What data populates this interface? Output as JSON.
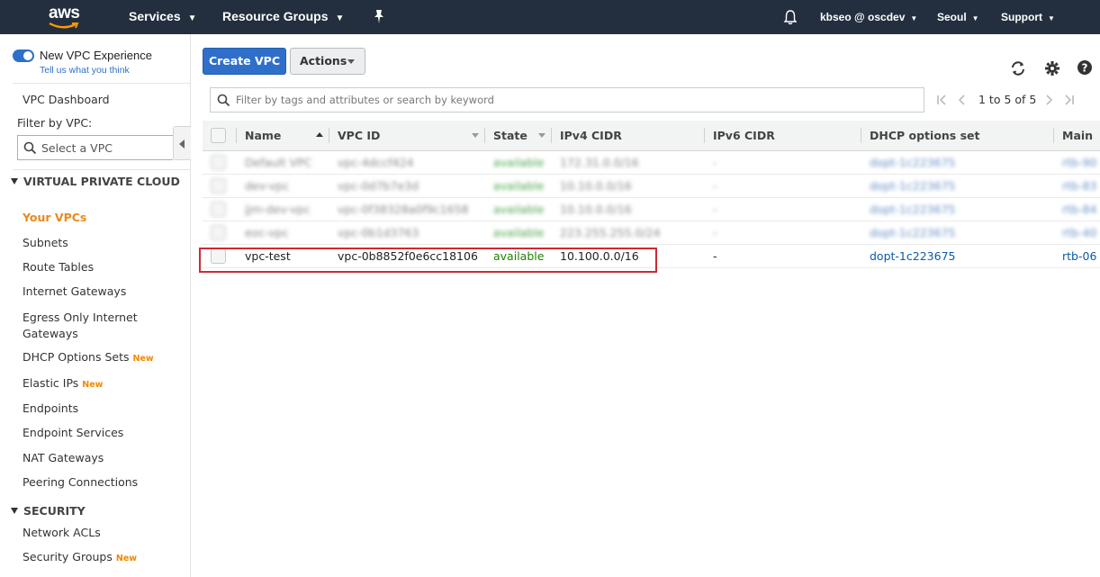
{
  "topnav": {
    "logo_text": "aws",
    "services": "Services",
    "resource_groups": "Resource Groups",
    "user": "kbseo @ oscdev",
    "region": "Seoul",
    "support": "Support"
  },
  "sidebar": {
    "experience_label": "New VPC Experience",
    "experience_link": "Tell us what you think",
    "dashboard": "VPC Dashboard",
    "filter_label": "Filter by VPC:",
    "select_placeholder": "Select a VPC",
    "section_vpc": "VIRTUAL PRIVATE CLOUD",
    "section_security": "SECURITY",
    "new_badge": "New",
    "items": [
      {
        "label": "Your VPCs",
        "active": true
      },
      {
        "label": "Subnets"
      },
      {
        "label": "Route Tables"
      },
      {
        "label": "Internet Gateways"
      },
      {
        "label": "Egress Only Internet Gateways"
      },
      {
        "label": "DHCP Options Sets",
        "badge": "New"
      },
      {
        "label": "Elastic IPs",
        "badge": "New"
      },
      {
        "label": "Endpoints"
      },
      {
        "label": "Endpoint Services"
      },
      {
        "label": "NAT Gateways"
      },
      {
        "label": "Peering Connections"
      }
    ],
    "security_items": [
      {
        "label": "Network ACLs"
      },
      {
        "label": "Security Groups",
        "badge": "New"
      }
    ]
  },
  "toolbar": {
    "create_label": "Create VPC",
    "actions_label": "Actions"
  },
  "search": {
    "placeholder": "Filter by tags and attributes or search by keyword"
  },
  "pager": {
    "text": "1 to 5 of 5"
  },
  "table": {
    "columns": [
      "Name",
      "VPC ID",
      "State",
      "IPv4 CIDR",
      "IPv6 CIDR",
      "DHCP options set",
      "Main"
    ],
    "rows": [
      {
        "name": "Default VPC",
        "vpc_id": "vpc-4dccf424",
        "state": "available",
        "ipv4": "172.31.0.0/16",
        "ipv6": "-",
        "dhcp": "dopt-1c223675",
        "main": "rtb-90",
        "blurred": true
      },
      {
        "name": "dev-vpc",
        "vpc_id": "vpc-0d7b7e3d",
        "state": "available",
        "ipv4": "10.10.0.0/16",
        "ipv6": "-",
        "dhcp": "dopt-1c223675",
        "main": "rtb-83",
        "blurred": true
      },
      {
        "name": "jjm-dev-vpc",
        "vpc_id": "vpc-0f38328a0f9c1658",
        "state": "available",
        "ipv4": "10.10.0.0/16",
        "ipv6": "-",
        "dhcp": "dopt-1c223675",
        "main": "rtb-84",
        "blurred": true
      },
      {
        "name": "eoc-vpc",
        "vpc_id": "vpc-0b1d3763",
        "state": "available",
        "ipv4": "223.255.255.0/24",
        "ipv6": "-",
        "dhcp": "dopt-1c223675",
        "main": "rtb-40",
        "blurred": true
      },
      {
        "name": "vpc-test",
        "vpc_id": "vpc-0b8852f0e6cc18106",
        "state": "available",
        "ipv4": "10.100.0.0/16",
        "ipv6": "-",
        "dhcp": "dopt-1c223675",
        "main": "rtb-06",
        "blurred": false
      }
    ]
  }
}
